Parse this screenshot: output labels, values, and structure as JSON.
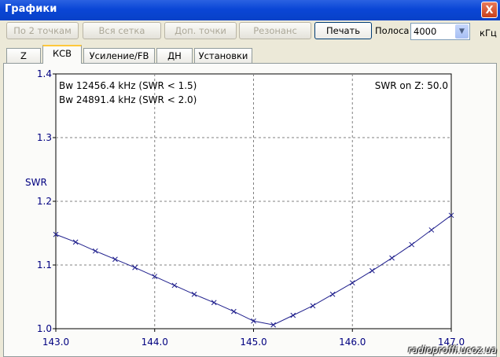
{
  "window": {
    "title": "Графики",
    "close_label": "X"
  },
  "toolbar": {
    "btn_two_points": "По 2 точкам",
    "btn_full_grid": "Вся сетка",
    "btn_extra_points": "Доп. точки",
    "btn_resonance": "Резонанс",
    "btn_print": "Печать",
    "band_label": "Полоса",
    "band_value": "4000",
    "band_unit": "кГц"
  },
  "tabs": [
    "Z",
    "КСВ",
    "Усиление/FB",
    "ДН",
    "Установки"
  ],
  "selected_tab": "КСВ",
  "watermark": "radioproffi.ucoz.ua",
  "chart_data": {
    "type": "line",
    "ylabel": "SWR",
    "xlim": [
      143.0,
      147.0
    ],
    "ylim": [
      1.0,
      1.4
    ],
    "x_ticks": [
      "143.0",
      "144.0",
      "145.0",
      "146.0",
      "147.0"
    ],
    "y_ticks": [
      "1.0",
      "1.1",
      "1.2",
      "1.3",
      "1.4"
    ],
    "grid": true,
    "annotations": {
      "bw1": "Bw 12456.4 kHz (SWR < 1.5)",
      "bw2": "Bw 24891.4 kHz (SWR < 2.0)",
      "z": "SWR on Z: 50.0"
    },
    "series": [
      {
        "x": [
          143.0,
          143.2,
          143.4,
          143.6,
          143.8,
          144.0,
          144.2,
          144.4,
          144.6,
          144.8,
          145.0,
          145.2,
          145.4,
          145.6,
          145.8,
          146.0,
          146.2,
          146.4,
          146.6,
          146.8,
          147.0
        ],
        "y": [
          1.148,
          1.136,
          1.122,
          1.109,
          1.096,
          1.082,
          1.068,
          1.054,
          1.041,
          1.027,
          1.012,
          1.006,
          1.021,
          1.036,
          1.054,
          1.072,
          1.091,
          1.111,
          1.132,
          1.155,
          1.178
        ],
        "color": "#1e1e8c"
      }
    ]
  }
}
